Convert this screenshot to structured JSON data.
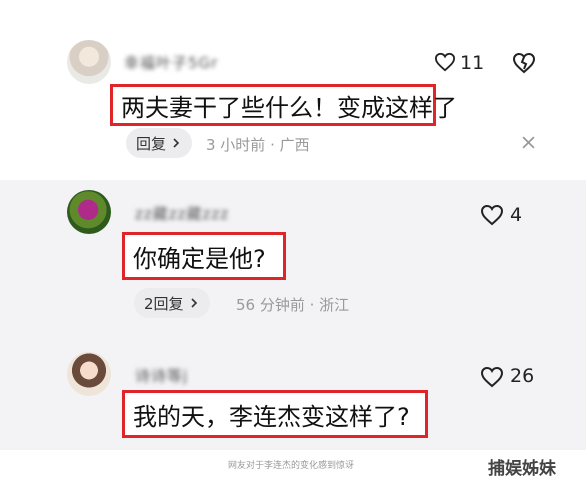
{
  "comments": [
    {
      "username": "幸福叶子5Gr",
      "text": "两夫妻干了些什么！变成这样了",
      "like_count": "11",
      "reply_label": "回复",
      "meta": "3 小时前 · 广西"
    },
    {
      "username": "zz藏zz藏zzz",
      "text": "你确定是他?",
      "like_count": "4",
      "reply_label": "2回复",
      "meta": "56 分钟前 · 浙江"
    },
    {
      "username": "诗诗等j",
      "text": "我的天，李连杰变这样了?",
      "like_count": "26"
    }
  ],
  "caption": "网友对于李连杰的变化感到惊讶",
  "watermark": "捕娱姊妹",
  "colors": {
    "highlight_border": "#e0252a",
    "secondary_bg": "#f3f3f5"
  },
  "icons": [
    "heart-icon",
    "broken-heart-icon",
    "close-icon",
    "chevron-right-icon"
  ]
}
